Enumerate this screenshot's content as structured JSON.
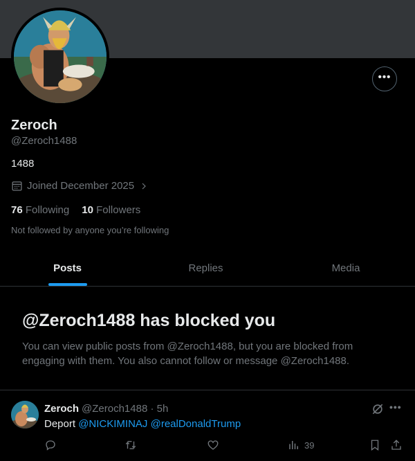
{
  "profile": {
    "name": "Zeroch",
    "handle": "@Zeroch1488",
    "bio": "1488",
    "joined": "Joined December 2025",
    "following_count": "76",
    "following_label": "Following",
    "followers_count": "10",
    "followers_label": "Followers",
    "not_followed_text": "Not followed by anyone you’re following"
  },
  "tabs": [
    {
      "label": "Posts",
      "active": true
    },
    {
      "label": "Replies",
      "active": false
    },
    {
      "label": "Media",
      "active": false
    }
  ],
  "blocked": {
    "title": "@Zeroch1488 has blocked you",
    "description": "You can view public posts from @Zeroch1488, but you are blocked from engaging with them. You also cannot follow or message @Zeroch1488."
  },
  "post": {
    "author_name": "Zeroch",
    "author_handle": "@Zeroch1488 · 5h",
    "text_prefix": "Deport",
    "mention1": "@NICKIMINAJ",
    "mention2": "@realDonaldTrump",
    "views": "39"
  },
  "colors": {
    "accent": "#1d9bf0",
    "secondary_text": "#71767b",
    "border": "#2f3336",
    "banner": "#333639"
  },
  "icons": {
    "more": "more-horizontal-icon",
    "calendar": "calendar-icon",
    "chevron": "chevron-right-icon",
    "reply": "reply-icon",
    "repost": "repost-icon",
    "like": "heart-icon",
    "views": "views-chart-icon",
    "bookmark": "bookmark-icon",
    "share": "share-icon",
    "grok": "grok-icon"
  }
}
